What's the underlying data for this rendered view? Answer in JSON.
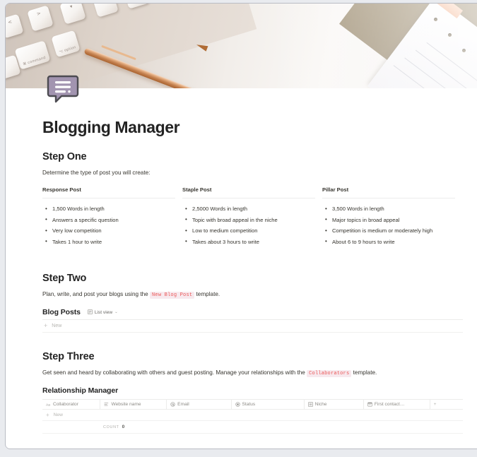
{
  "page": {
    "icon_name": "speech-bubble-icon",
    "icon_color": "#9b8aa8",
    "cover_alt": "keyboard-pen-notepad-photo",
    "title": "Blogging Manager"
  },
  "step_one": {
    "heading": "Step One",
    "intro": "Determine the type of post you will create:",
    "columns": [
      {
        "heading": "Response Post",
        "items": [
          "1,500 Words in length",
          "Answers a specific question",
          "Very low competition",
          "Takes 1 hour to write"
        ]
      },
      {
        "heading": "Staple Post",
        "items": [
          "2,5000 Words in length",
          "Topic with broad appeal in the niche",
          "Low to medium competition",
          "Takes about 3 hours to write"
        ]
      },
      {
        "heading": "Pillar Post",
        "items": [
          "3,500 Words in length",
          "Major topics in broad appeal",
          "Competition is medium or moderately high",
          "About 6 to 9 hours to write"
        ]
      }
    ]
  },
  "step_two": {
    "heading": "Step Two",
    "intro_before": "Plan, write, and post your blogs using the",
    "intro_chip": "New Blog Post",
    "intro_after": "template.",
    "database": {
      "title": "Blog Posts",
      "view_label": "List view",
      "view_icon": "list-view-icon",
      "chevron": "⌄",
      "new_label": "New",
      "new_icon": "plus-icon"
    }
  },
  "step_three": {
    "heading": "Step Three",
    "intro_before": "Get seen and heard by collaborating with others and guest posting. Manage your relationships with the",
    "intro_chip": "Collaborators",
    "intro_after": "template.",
    "database": {
      "title": "Relationship Manager",
      "columns": [
        {
          "label": "Collaborator",
          "icon": "title-text-icon",
          "icon_glyph": "Aa"
        },
        {
          "label": "Website name",
          "icon": "text-icon",
          "icon_glyph": "≡"
        },
        {
          "label": "Email",
          "icon": "email-icon",
          "icon_glyph": "@"
        },
        {
          "label": "Status",
          "icon": "status-icon",
          "icon_glyph": "◉"
        },
        {
          "label": "Niche",
          "icon": "select-icon",
          "icon_glyph": "≣"
        },
        {
          "label": "First contact…",
          "icon": "date-icon",
          "icon_glyph": "▤"
        }
      ],
      "add_column_label": "+",
      "new_label": "New",
      "new_icon": "plus-icon",
      "count_label": "COUNT",
      "count_value": "0"
    }
  },
  "colors": {
    "code_text": "#eb5757",
    "code_bg": "#f7e9ee",
    "text": "#37352f",
    "muted": "#8d8b86",
    "placeholder": "#b6b5b1",
    "border": "#ececeb",
    "window_bg": "#e9ebef"
  }
}
